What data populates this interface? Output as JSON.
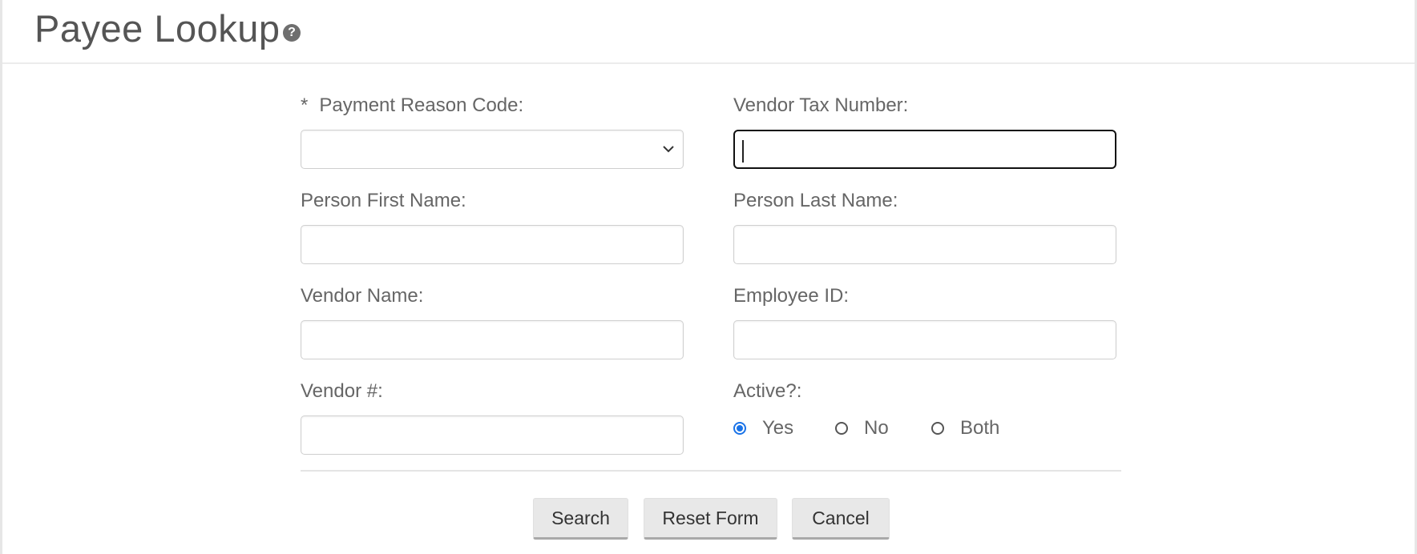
{
  "header": {
    "title": "Payee Lookup",
    "help_glyph": "?"
  },
  "form": {
    "payment_reason_code": {
      "required_marker": "*",
      "label": "Payment Reason Code:",
      "value": ""
    },
    "vendor_tax_number": {
      "label": "Vendor Tax Number:",
      "value": ""
    },
    "person_first_name": {
      "label": "Person First Name:",
      "value": ""
    },
    "person_last_name": {
      "label": "Person Last Name:",
      "value": ""
    },
    "vendor_name": {
      "label": "Vendor Name:",
      "value": ""
    },
    "employee_id": {
      "label": "Employee ID:",
      "value": ""
    },
    "vendor_number": {
      "label": "Vendor #:",
      "value": ""
    },
    "active": {
      "label": "Active?:",
      "options": [
        {
          "label": "Yes",
          "checked": true
        },
        {
          "label": "No",
          "checked": false
        },
        {
          "label": "Both",
          "checked": false
        }
      ]
    }
  },
  "buttons": {
    "search": "Search",
    "reset": "Reset Form",
    "cancel": "Cancel"
  },
  "colors": {
    "radio_checked": "#1a73e8",
    "focus_border": "#111111"
  },
  "icons": {
    "help": "help-circle-icon",
    "select_arrow": "chevron-down-icon"
  }
}
